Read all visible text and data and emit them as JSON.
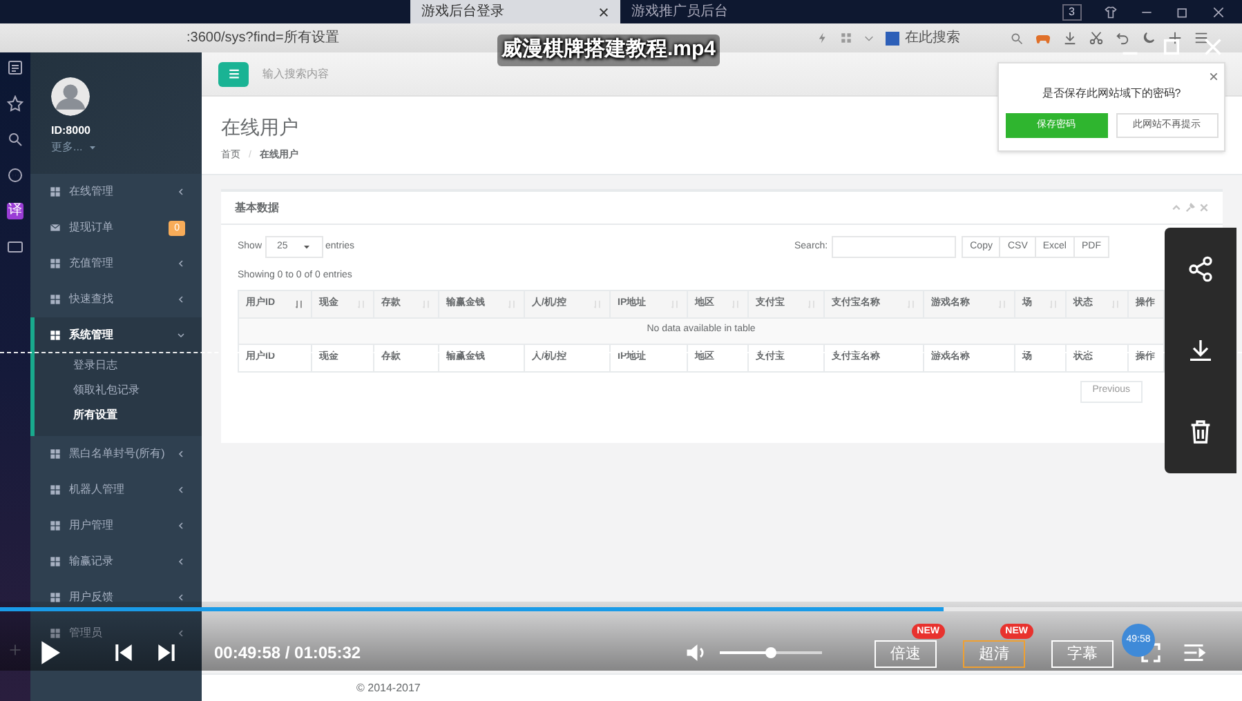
{
  "browser": {
    "tabs": [
      {
        "title": "游戏后台登录",
        "selected": true
      },
      {
        "title": "游戏推广员后台",
        "selected": false
      }
    ],
    "tab_count": "3",
    "address": ":3600/sys?find=所有设置",
    "search_placeholder": "在此搜索",
    "translate_label": "译"
  },
  "video": {
    "title": "威漫棋牌搭建教程.mp4"
  },
  "profile": {
    "id": "ID:8000",
    "more": "更多..."
  },
  "menu": [
    {
      "label": "在线管理",
      "kind": "grid",
      "selected": false,
      "expanded": false
    },
    {
      "label": "提现订单",
      "kind": "mail",
      "badge": "0",
      "selected": false,
      "expanded": false
    },
    {
      "label": "充值管理",
      "kind": "grid",
      "selected": false,
      "expanded": false
    },
    {
      "label": "快速查找",
      "kind": "grid",
      "selected": false,
      "expanded": false
    },
    {
      "label": "系统管理",
      "kind": "grid",
      "selected": true,
      "expanded": true,
      "children": [
        {
          "label": "登录日志",
          "selected": false
        },
        {
          "label": "领取礼包记录",
          "selected": false
        },
        {
          "label": "所有设置",
          "selected": true
        }
      ]
    },
    {
      "label": "黑白名单封号(所有)",
      "kind": "grid",
      "selected": false,
      "expanded": false
    },
    {
      "label": "机器人管理",
      "kind": "grid",
      "selected": false,
      "expanded": false
    },
    {
      "label": "用户管理",
      "kind": "grid",
      "selected": false,
      "expanded": false
    },
    {
      "label": "输赢记录",
      "kind": "grid",
      "selected": false,
      "expanded": false
    },
    {
      "label": "用户反馈",
      "kind": "grid",
      "selected": false,
      "expanded": false
    },
    {
      "label": "管理员",
      "kind": "grid",
      "selected": false,
      "expanded": false
    }
  ],
  "header": {
    "search_placeholder": "输入搜索内容"
  },
  "page": {
    "title": "在线用户",
    "breadcrumb": [
      "首页",
      "在线用户"
    ],
    "breadcrumb_separator": "/",
    "footer": "© 2014-2017"
  },
  "card": {
    "title": "基本数据",
    "show_label": "Show",
    "page_length": "25",
    "entries_label": "entries",
    "search_label": "Search:",
    "export_buttons": [
      "Copy",
      "CSV",
      "Excel",
      "PDF"
    ],
    "info": "Showing 0 to 0 of 0 entries",
    "columns": [
      {
        "label": "用户ID",
        "sorted": true
      },
      {
        "label": "现金",
        "sorted": false
      },
      {
        "label": "存款",
        "sorted": false
      },
      {
        "label": "输赢金钱",
        "sorted": false
      },
      {
        "label": "人/机/控",
        "sorted": false
      },
      {
        "label": "IP地址",
        "sorted": false
      },
      {
        "label": "地区",
        "sorted": false
      },
      {
        "label": "支付宝",
        "sorted": false
      },
      {
        "label": "支付宝名称",
        "sorted": false
      },
      {
        "label": "游戏名称",
        "sorted": false
      },
      {
        "label": "场",
        "sorted": false
      },
      {
        "label": "状态",
        "sorted": false
      },
      {
        "label": "操作"
      }
    ],
    "footer_columns": [
      "用户ID",
      "现金",
      "存款",
      "输赢金钱",
      "人/机/控",
      "IP地址",
      "地区",
      "支付宝",
      "支付宝名称",
      "游戏名称",
      "场",
      "状态",
      "操作"
    ],
    "empty_message": "No data available in table",
    "pagination": [
      "Previous"
    ]
  },
  "password_prompt": {
    "message": "是否保存此网站域下的密码?",
    "buttons": [
      {
        "label": "保存密码",
        "kind": "primary"
      },
      {
        "label": "此网站不再提示",
        "kind": "secondary"
      }
    ]
  },
  "player": {
    "progress": {
      "level": 0.76
    },
    "time": "00:49:58 / 01:05:32",
    "volume": {
      "level": 0.5
    },
    "buttons": [
      {
        "label": "倍速",
        "badge": "NEW",
        "highlighted": false
      },
      {
        "label": "超清",
        "badge": "NEW",
        "highlighted": true
      },
      {
        "label": "字幕",
        "highlighted": false
      }
    ],
    "preview_time": "49:58"
  }
}
